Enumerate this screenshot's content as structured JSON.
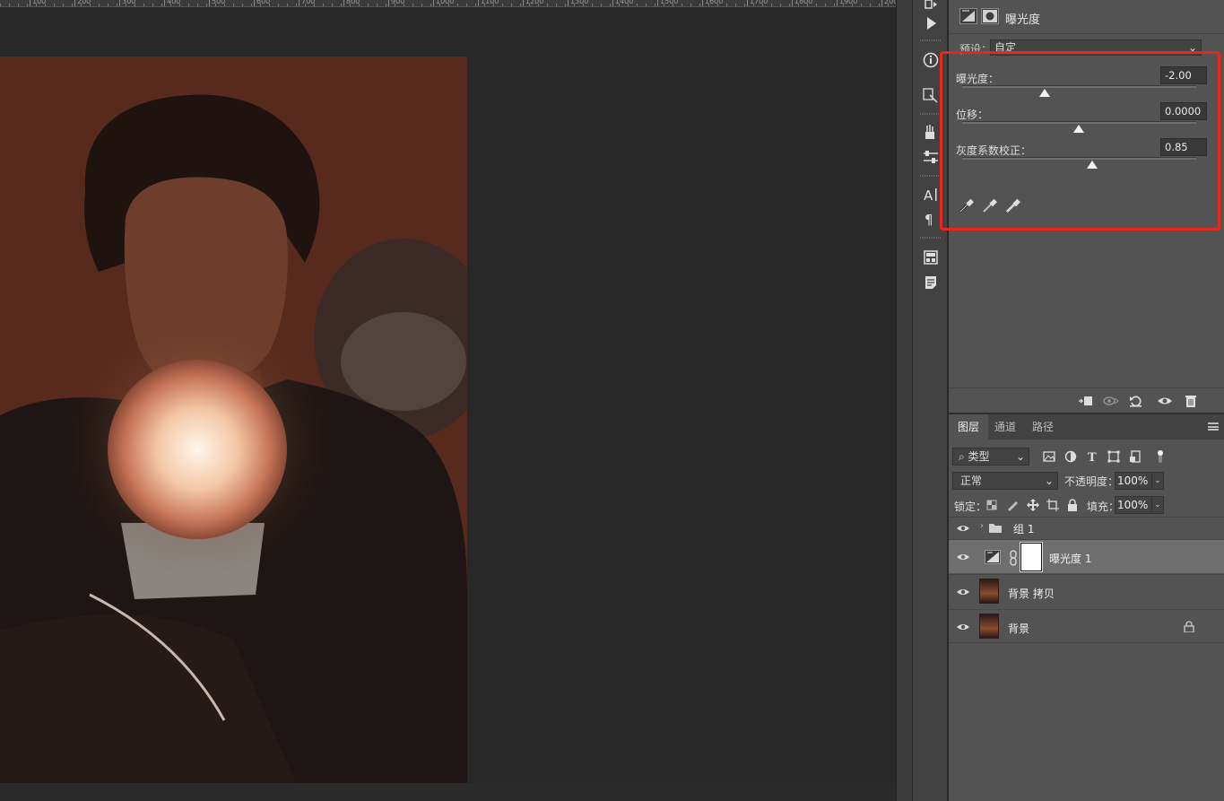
{
  "ruler": {
    "labels": [
      "100",
      "200",
      "300",
      "400",
      "500",
      "600",
      "700",
      "800",
      "900",
      "1000",
      "1100",
      "1200",
      "1300",
      "1400",
      "1500",
      "1600",
      "1700",
      "1800",
      "1900",
      "200"
    ]
  },
  "properties": {
    "title": "曝光度",
    "preset_label": "预设：",
    "preset_value": "自定",
    "sliders": [
      {
        "label": "曝光度：",
        "value": "-2.00",
        "thumb_position": 0.35
      },
      {
        "label": "位移：",
        "value": "0.0000",
        "thumb_position": 0.5
      },
      {
        "label": "灰度系数校正：",
        "value": "0.85",
        "thumb_position": 0.55
      }
    ],
    "eyedroppers": [
      "black-point-eyedropper-icon",
      "gray-point-eyedropper-icon",
      "white-point-eyedropper-icon"
    ],
    "footer_icons": [
      "clip-to-layer-icon",
      "view-previous-state-icon",
      "reset-icon",
      "visibility-eye-icon",
      "trash-icon"
    ]
  },
  "layers_panel": {
    "tabs": [
      "图层",
      "通道",
      "路径"
    ],
    "active_tab": "图层",
    "filter_label": "类型",
    "blend_mode": "正常",
    "opacity_label": "不透明度：",
    "opacity_value": "100%",
    "lock_label": "锁定：",
    "fill_label": "填充：",
    "fill_value": "100%",
    "layers": [
      {
        "name": "组 1",
        "type": "group",
        "visible": true,
        "selected": false
      },
      {
        "name": "曝光度 1",
        "type": "adjustment",
        "visible": true,
        "selected": true
      },
      {
        "name": "背景 拷贝",
        "type": "pixel",
        "visible": true,
        "selected": false
      },
      {
        "name": "背景",
        "type": "pixel",
        "visible": true,
        "selected": false,
        "locked": true
      }
    ]
  },
  "colors": {
    "highlight": "#e8261c",
    "panel_bg": "#535353",
    "canvas_bg": "#282828"
  }
}
